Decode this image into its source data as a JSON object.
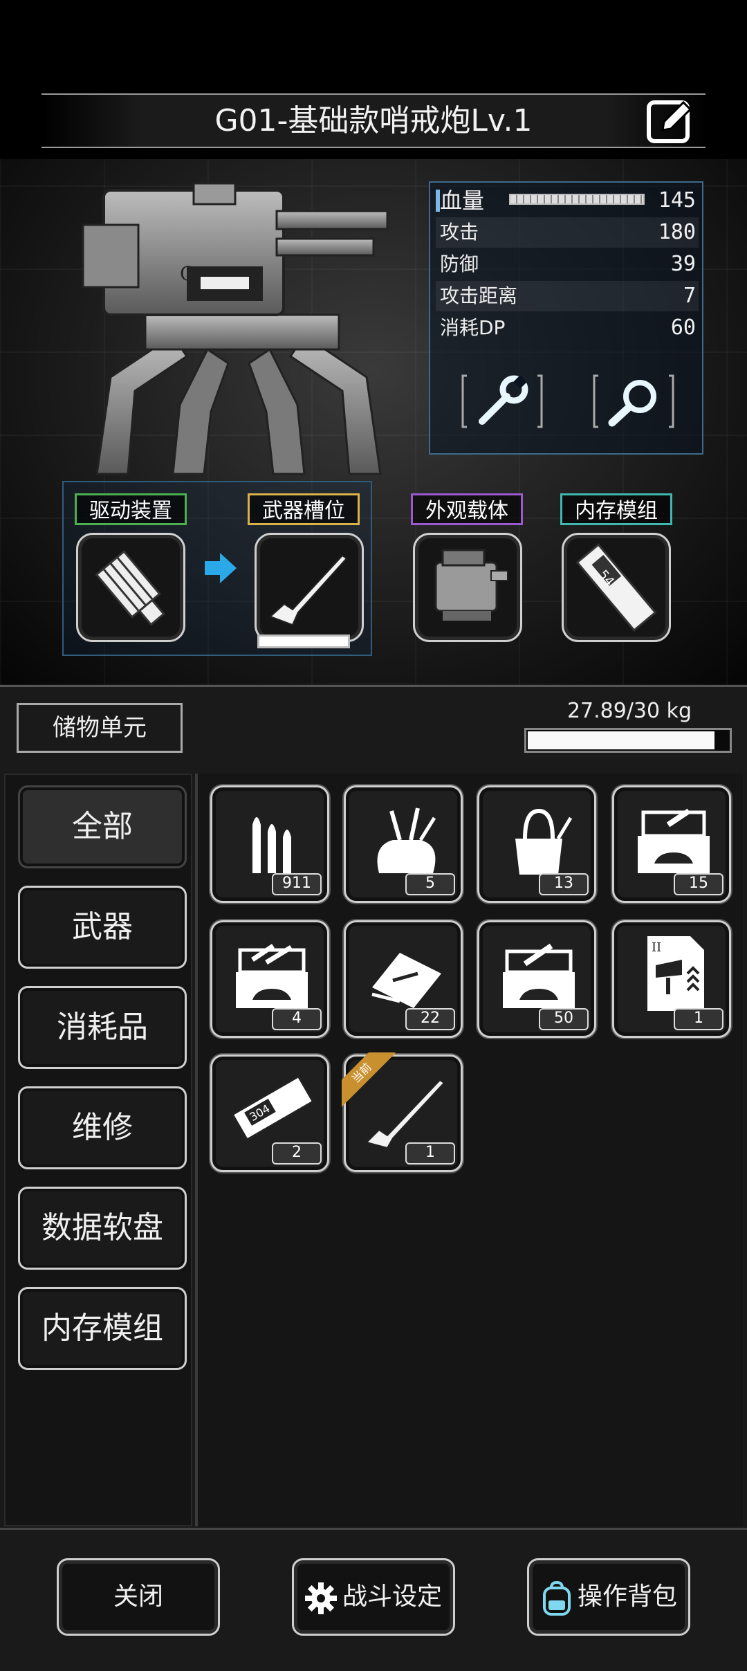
{
  "header": {
    "title": "G01-基础款哨戒炮Lv.1"
  },
  "stats": [
    {
      "label": "血量",
      "value": "145"
    },
    {
      "label": "攻击",
      "value": "180"
    },
    {
      "label": "防御",
      "value": "39"
    },
    {
      "label": "攻击距离",
      "value": "7"
    },
    {
      "label": "消耗DP",
      "value": "60"
    }
  ],
  "slots": [
    {
      "label": "驱动装置",
      "color": "#4caf50"
    },
    {
      "label": "武器槽位",
      "color": "#d9b24a"
    },
    {
      "label": "外观载体",
      "color": "#9b59d0"
    },
    {
      "label": "内存模组",
      "color": "#3fb8b0"
    }
  ],
  "slot_icons": {
    "drive": "motor-icon",
    "weapon": "rifle-icon",
    "skin": "turret-icon",
    "memory": "memory-chip-icon",
    "memory_number": "54"
  },
  "inventory": {
    "storage_label": "储物单元",
    "weight": "27.89/30 kg",
    "weight_ratio": 0.9297
  },
  "categories": [
    "全部",
    "武器",
    "消耗品",
    "维修",
    "数据软盘",
    "内存模组"
  ],
  "items": [
    {
      "icon": "bullets-icon",
      "count": "911"
    },
    {
      "icon": "pouch-tools-icon",
      "count": "5"
    },
    {
      "icon": "tool-bag-icon",
      "count": "13"
    },
    {
      "icon": "car-toolbox-icon",
      "count": "15"
    },
    {
      "icon": "toolbox-icon",
      "count": "4"
    },
    {
      "icon": "tool-tray-icon",
      "count": "22"
    },
    {
      "icon": "repair-kit-icon",
      "count": "50"
    },
    {
      "icon": "data-card-icon",
      "count": "1",
      "card_mark": "II"
    },
    {
      "icon": "memory-module-icon",
      "count": "2",
      "chip_number": "304"
    },
    {
      "icon": "rifle-icon",
      "count": "1",
      "tag": "当前"
    }
  ],
  "buttons": {
    "close": "关闭",
    "battle": "战斗设定",
    "backpack": "操作背包"
  },
  "colors": {
    "accent_blue": "#2aa8e8",
    "panel_border": "#3f6a8a"
  }
}
